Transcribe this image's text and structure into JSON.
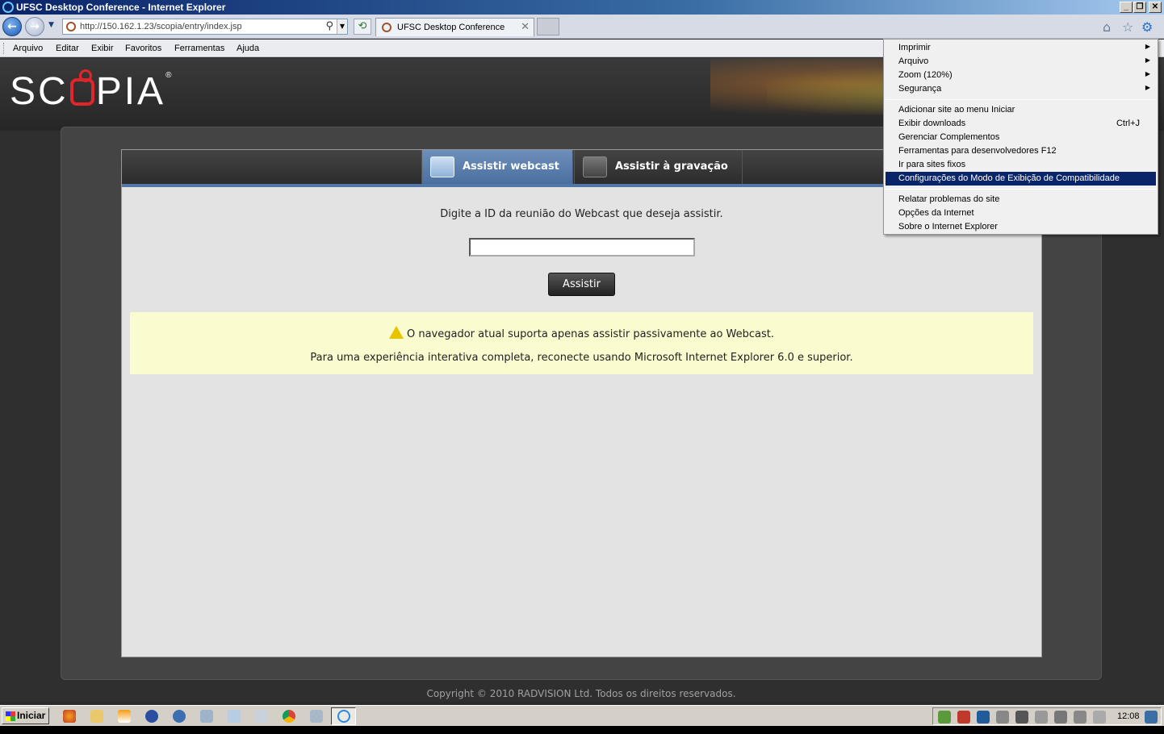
{
  "window": {
    "title": "UFSC Desktop Conference - Internet Explorer",
    "minimize_glyph": "_",
    "restore_glyph": "❐",
    "close_glyph": "✕"
  },
  "address_bar": {
    "url": "http://150.162.1.23/scopia/entry/index.jsp",
    "back_glyph": "←",
    "forward_glyph": "→"
  },
  "tab": {
    "title": "UFSC Desktop Conference",
    "close_glyph": "✕"
  },
  "menubar": {
    "items": [
      "Arquivo",
      "Editar",
      "Exibir",
      "Favoritos",
      "Ferramentas",
      "Ajuda"
    ]
  },
  "page": {
    "logo_text_left": "SC",
    "logo_text_right": "PIA",
    "logo_reg": "®",
    "tabs": [
      {
        "label": "Assistir webcast",
        "icon": "webcam-icon",
        "active": true
      },
      {
        "label": "Assistir à gravação",
        "icon": "film-play-icon",
        "active": false
      }
    ],
    "prompt": "Digite a ID da reunião do Webcast que deseja assistir.",
    "meeting_id_value": "",
    "watch_button": "Assistir",
    "notice_line1": "O navegador atual suporta apenas assistir passivamente ao Webcast.",
    "notice_line2": "Para uma experiência interativa completa, reconecte usando Microsoft Internet Explorer 6.0 e superior.",
    "copyright": "Copyright © 2010 RADVISION Ltd. Todos os direitos reservados."
  },
  "tools_menu": {
    "group1": [
      {
        "label": "Imprimir",
        "submenu": true
      },
      {
        "label": "Arquivo",
        "submenu": true
      },
      {
        "label": "Zoom (120%)",
        "submenu": true
      },
      {
        "label": "Segurança",
        "submenu": true
      }
    ],
    "group2": [
      {
        "label": "Adicionar site ao menu Iniciar",
        "shortcut": ""
      },
      {
        "label": "Exibir downloads",
        "shortcut": "Ctrl+J"
      },
      {
        "label": "Gerenciar Complementos",
        "shortcut": ""
      },
      {
        "label": "Ferramentas para desenvolvedores F12",
        "shortcut": ""
      },
      {
        "label": "Ir para sites fixos",
        "shortcut": ""
      },
      {
        "label": "Configurações do Modo de Exibição de Compatibilidade",
        "shortcut": "",
        "highlighted": true
      }
    ],
    "group3": [
      {
        "label": "Relatar problemas do site"
      },
      {
        "label": "Opções da Internet"
      },
      {
        "label": "Sobre o Internet Explorer"
      }
    ],
    "arrow_glyph": "▶"
  },
  "taskbar": {
    "start_label": "Iniciar",
    "clock": "12:08",
    "quick_launch": [
      "firefox-icon",
      "folder-icon",
      "vlc-icon",
      "app-icon",
      "app-icon",
      "search-icon",
      "app-icon",
      "calculator-icon",
      "chrome-icon",
      "app-icon"
    ]
  },
  "colors": {
    "highlight": "#0a246a",
    "tab_active": "#5a7fb0",
    "notice_bg": "#fbfbd0",
    "logo_accent": "#e0262a"
  }
}
